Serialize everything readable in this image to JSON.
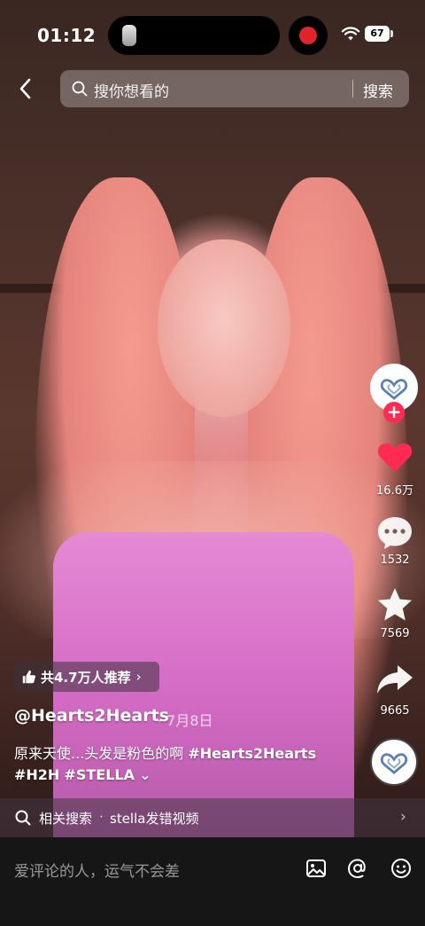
{
  "status_bar": {
    "time": "01:12",
    "battery": "67"
  },
  "search": {
    "placeholder": "搜你想看的",
    "button": "搜索"
  },
  "actions": {
    "likes": "16.6万",
    "comments": "1532",
    "favorites": "7569",
    "shares": "9665"
  },
  "video_info": {
    "recommend": "共4.7万人推荐",
    "author": "@Hearts2Hearts",
    "date": "· 7月8日",
    "caption_text": "原来天使...头发是粉色的啊 ",
    "tags": [
      "#Hearts2Hearts",
      "#H2H",
      "#STELLA"
    ]
  },
  "related": {
    "label": "相关搜索",
    "separator": "·",
    "query": "stella发错视频"
  },
  "comment_bar": {
    "placeholder": "爱评论的人，运气不会差"
  },
  "colors": {
    "accent": "#ff2b55",
    "like": "#ff2b55",
    "background": "#161616"
  }
}
